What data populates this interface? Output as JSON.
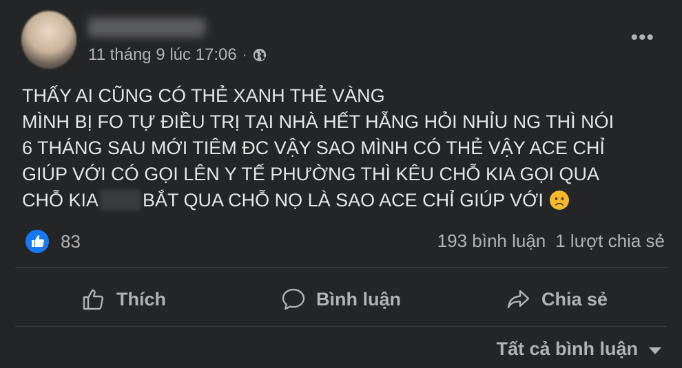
{
  "post": {
    "timestamp": "11 tháng 9 lúc 17:06",
    "separator": "·",
    "more_label": "•••",
    "body_lines": [
      "THẤY AI CŨNG CÓ THẺ XANH THẺ VÀNG",
      "MÌNH BỊ FO TỰ ĐIỀU TRỊ TẠI NHÀ HẾT HẴNG HỎI NHỈU NG THÌ NÓI",
      "6 THÁNG SAU MỚI TIÊM ĐC VẬY SAO MÌNH CÓ THẺ VẬY ACE CHỈ",
      "GIÚP VỚI CÓ GỌI LÊN Y TẾ PHƯỜNG THÌ KÊU CHỖ KIA GỌI QUA"
    ],
    "last_line_before": "CHỖ KIA",
    "last_line_after": "BẮT QUA CHỖ NỌ LÀ SAO ACE CHỈ GIÚP VỚI"
  },
  "stats": {
    "likes": "83",
    "comments": "193 bình luận",
    "shares": "1 lượt chia sẻ"
  },
  "actions": {
    "like": "Thích",
    "comment": "Bình luận",
    "share": "Chia sẻ"
  },
  "comments_filter": "Tất cả bình luận",
  "colors": {
    "background": "#242526",
    "text": "#e4e6eb",
    "secondary": "#b0b3b8",
    "like_blue": "#1877f2"
  }
}
